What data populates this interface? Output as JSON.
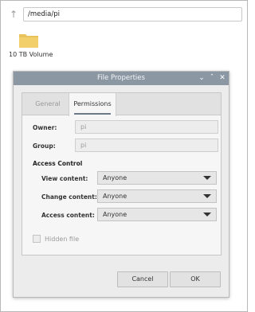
{
  "path_bar": {
    "path": "/media/pi"
  },
  "desktop": {
    "folder_label": "10 TB Volume"
  },
  "dialog": {
    "title": "File Properties",
    "tabs": [
      {
        "label": "General",
        "active": false
      },
      {
        "label": "Permissions",
        "active": true
      }
    ],
    "owner": {
      "label": "Owner:",
      "value": "pi"
    },
    "group": {
      "label": "Group:",
      "value": "pi"
    },
    "access_control": {
      "title": "Access Control",
      "rows": [
        {
          "label": "View content:",
          "value": "Anyone"
        },
        {
          "label": "Change content:",
          "value": "Anyone"
        },
        {
          "label": "Access content:",
          "value": "Anyone"
        }
      ]
    },
    "hidden_file": {
      "label": "Hidden file",
      "checked": false
    },
    "buttons": {
      "cancel": "Cancel",
      "ok": "OK"
    }
  },
  "colors": {
    "titlebar": "#8b97a2",
    "dialog_bg": "#ececec"
  }
}
